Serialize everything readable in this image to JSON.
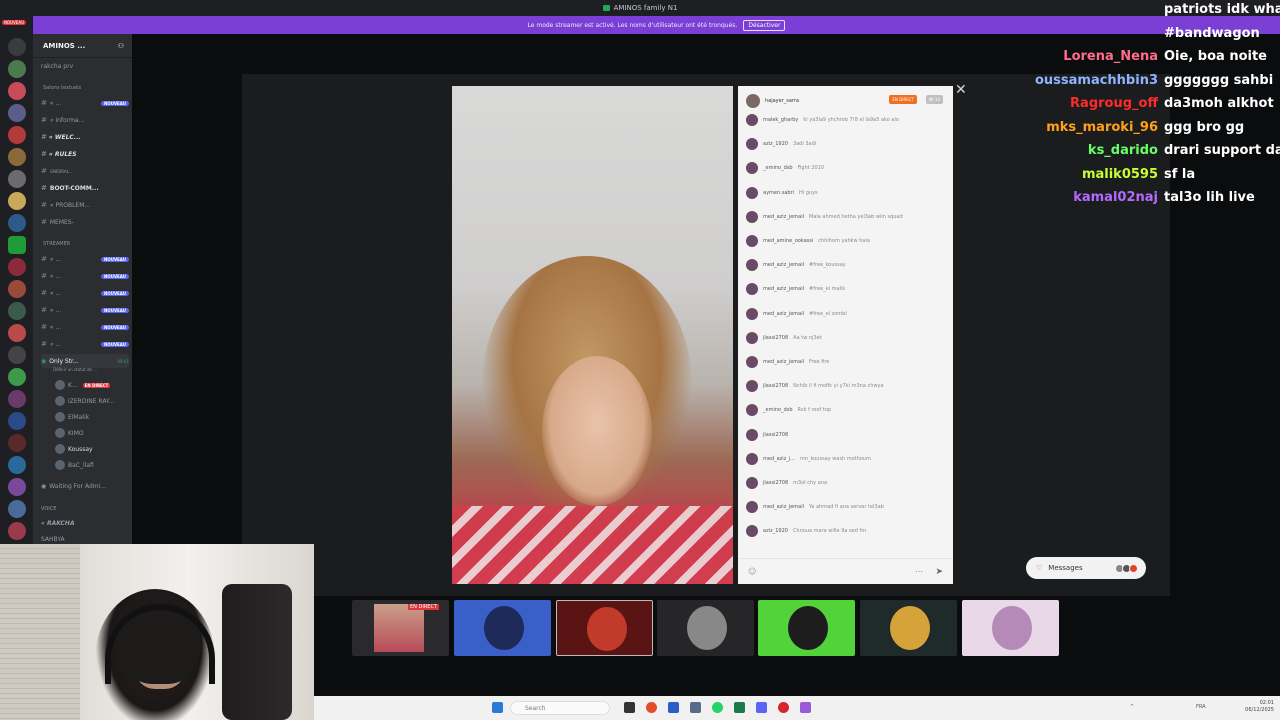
{
  "window": {
    "title": "AMINOS family N1"
  },
  "streamer_banner": {
    "text": "Le mode streamer est activé. Les noms d'utilisateur ont été tronqués.",
    "button": "Désactiver"
  },
  "rail": {
    "badge": "NOUVEAU"
  },
  "sidebar": {
    "server_name": "AMINOS ...",
    "items": [
      {
        "label": "rakcha prv",
        "badge": ""
      },
      {
        "label": "Salons textuels",
        "badge": ""
      },
      {
        "label": "« ...",
        "badge": "NOUVEAU"
      },
      {
        "label": "« informa...",
        "badge": ""
      },
      {
        "label": "« WELC...",
        "badge": ""
      },
      {
        "label": "« RULES",
        "badge": ""
      },
      {
        "label": "GNERRAL...",
        "badge": ""
      },
      {
        "label": "BOOT-COMM...",
        "badge": ""
      },
      {
        "label": "« PROBLEM...",
        "badge": ""
      },
      {
        "label": "MEMES-",
        "badge": ""
      },
      {
        "label": "STREAMER",
        "badge": ""
      },
      {
        "label": "« ...",
        "badge": "NOUVEAU"
      },
      {
        "label": "« ...",
        "badge": "NOUVEAU"
      },
      {
        "label": "« ...",
        "badge": "NOUVEAU"
      },
      {
        "label": "« ...",
        "badge": "NOUVEAU"
      },
      {
        "label": "« ...",
        "badge": "NOUVEAU"
      },
      {
        "label": "« ...",
        "badge": "NOUVEAU"
      }
    ],
    "voice_channel": {
      "label": "Only Str...",
      "time": "09:01",
      "sub": "Définir un statut de ..."
    },
    "voice_users": [
      {
        "name": "K...",
        "badge": "EN DIRECT"
      },
      {
        "name": "IZERDINE RAY...",
        "badge": ""
      },
      {
        "name": "ElMalik",
        "badge": ""
      },
      {
        "name": "KIMO",
        "badge": ""
      },
      {
        "name": "Koussay",
        "badge": ""
      },
      {
        "name": "BaC_llafl",
        "badge": ""
      }
    ],
    "waiting": "Waiting For Admi...",
    "voice_cat": "VOICE",
    "rakcha": "« RAKCHA",
    "sahbya": "SAHBYA"
  },
  "stream": {
    "host": "hajayer_sarra",
    "live_tag": "EN DIRECT",
    "viewers": "14",
    "close_icon": "close-icon",
    "chat": [
      {
        "user": "malek_gharby",
        "text": "ki ya3la9 yhchrob 7!8 el la9a5 ako alo"
      },
      {
        "user": "aziz_1920",
        "text": "3adi 3adi"
      },
      {
        "user": "_emino_dsb",
        "text": "Fight 2010"
      },
      {
        "user": "aymen.sabri",
        "text": "Hi guys"
      },
      {
        "user": "med_aziz_jemail",
        "text": "Mala ahmed hetha yel3ab wiin squad"
      },
      {
        "user": "med_amine_ookassi",
        "text": "chhihom yahkw hala"
      },
      {
        "user": "med_aziz_jemail",
        "text": "#free_koussay"
      },
      {
        "user": "med_aziz_jemail",
        "text": "#free_el malik"
      },
      {
        "user": "med_aziz_jemail",
        "text": "#free_el zombi"
      },
      {
        "user": "jlassi2708",
        "text": "Aa tw nj3et"
      },
      {
        "user": "med_aziz_jemail",
        "text": "Free fire"
      },
      {
        "user": "jlassi2708",
        "text": "Nchib il fi mofik yi y7ki m3na chwya"
      },
      {
        "user": "_emino_dsb",
        "text": "Rsk f roof top"
      },
      {
        "user": "jlassi2708",
        "text": ""
      },
      {
        "user": "med_aziz_j...",
        "text": "mn_koussay wash mothoum"
      },
      {
        "user": "jlassi2708",
        "text": "m3ol chy ana"
      },
      {
        "user": "med_aziz_jemail",
        "text": "Ya ahmad fi ana server tel3ab"
      },
      {
        "user": "aziz_1920",
        "text": "Chnoua mara wille 9a sed fm"
      }
    ],
    "input_placeholder": "",
    "messages_pill": "Messages"
  },
  "twitch_chat": [
    {
      "name": "",
      "color": "#ffffff",
      "text": "patriots idk what i"
    },
    {
      "name": "",
      "color": "#ffffff",
      "text": "#bandwagon"
    },
    {
      "name": "Lorena_Nena",
      "color": "#ff6b8a",
      "text": "Oie, boa noite"
    },
    {
      "name": "oussamachhbin3",
      "color": "#8fb4ff",
      "text": "ggggggg sahbi"
    },
    {
      "name": "Ragroug_off",
      "color": "#ff2b2b",
      "text": "da3moh alkhot"
    },
    {
      "name": "mks_maroki_96",
      "color": "#ffa21a",
      "text": "ggg bro gg"
    },
    {
      "name": "ks_darido",
      "color": "#66ff66",
      "text": "drari support dari"
    },
    {
      "name": "malik0595",
      "color": "#c7ff33",
      "text": "sf la"
    },
    {
      "name": "kamal02naj",
      "color": "#b36bff",
      "text": "tal3o lih live"
    }
  ],
  "taskbar": {
    "search_placeholder": "Search",
    "lang": "FRA",
    "lang2": "FR",
    "time": "02:01",
    "date": "06/12/2025"
  }
}
